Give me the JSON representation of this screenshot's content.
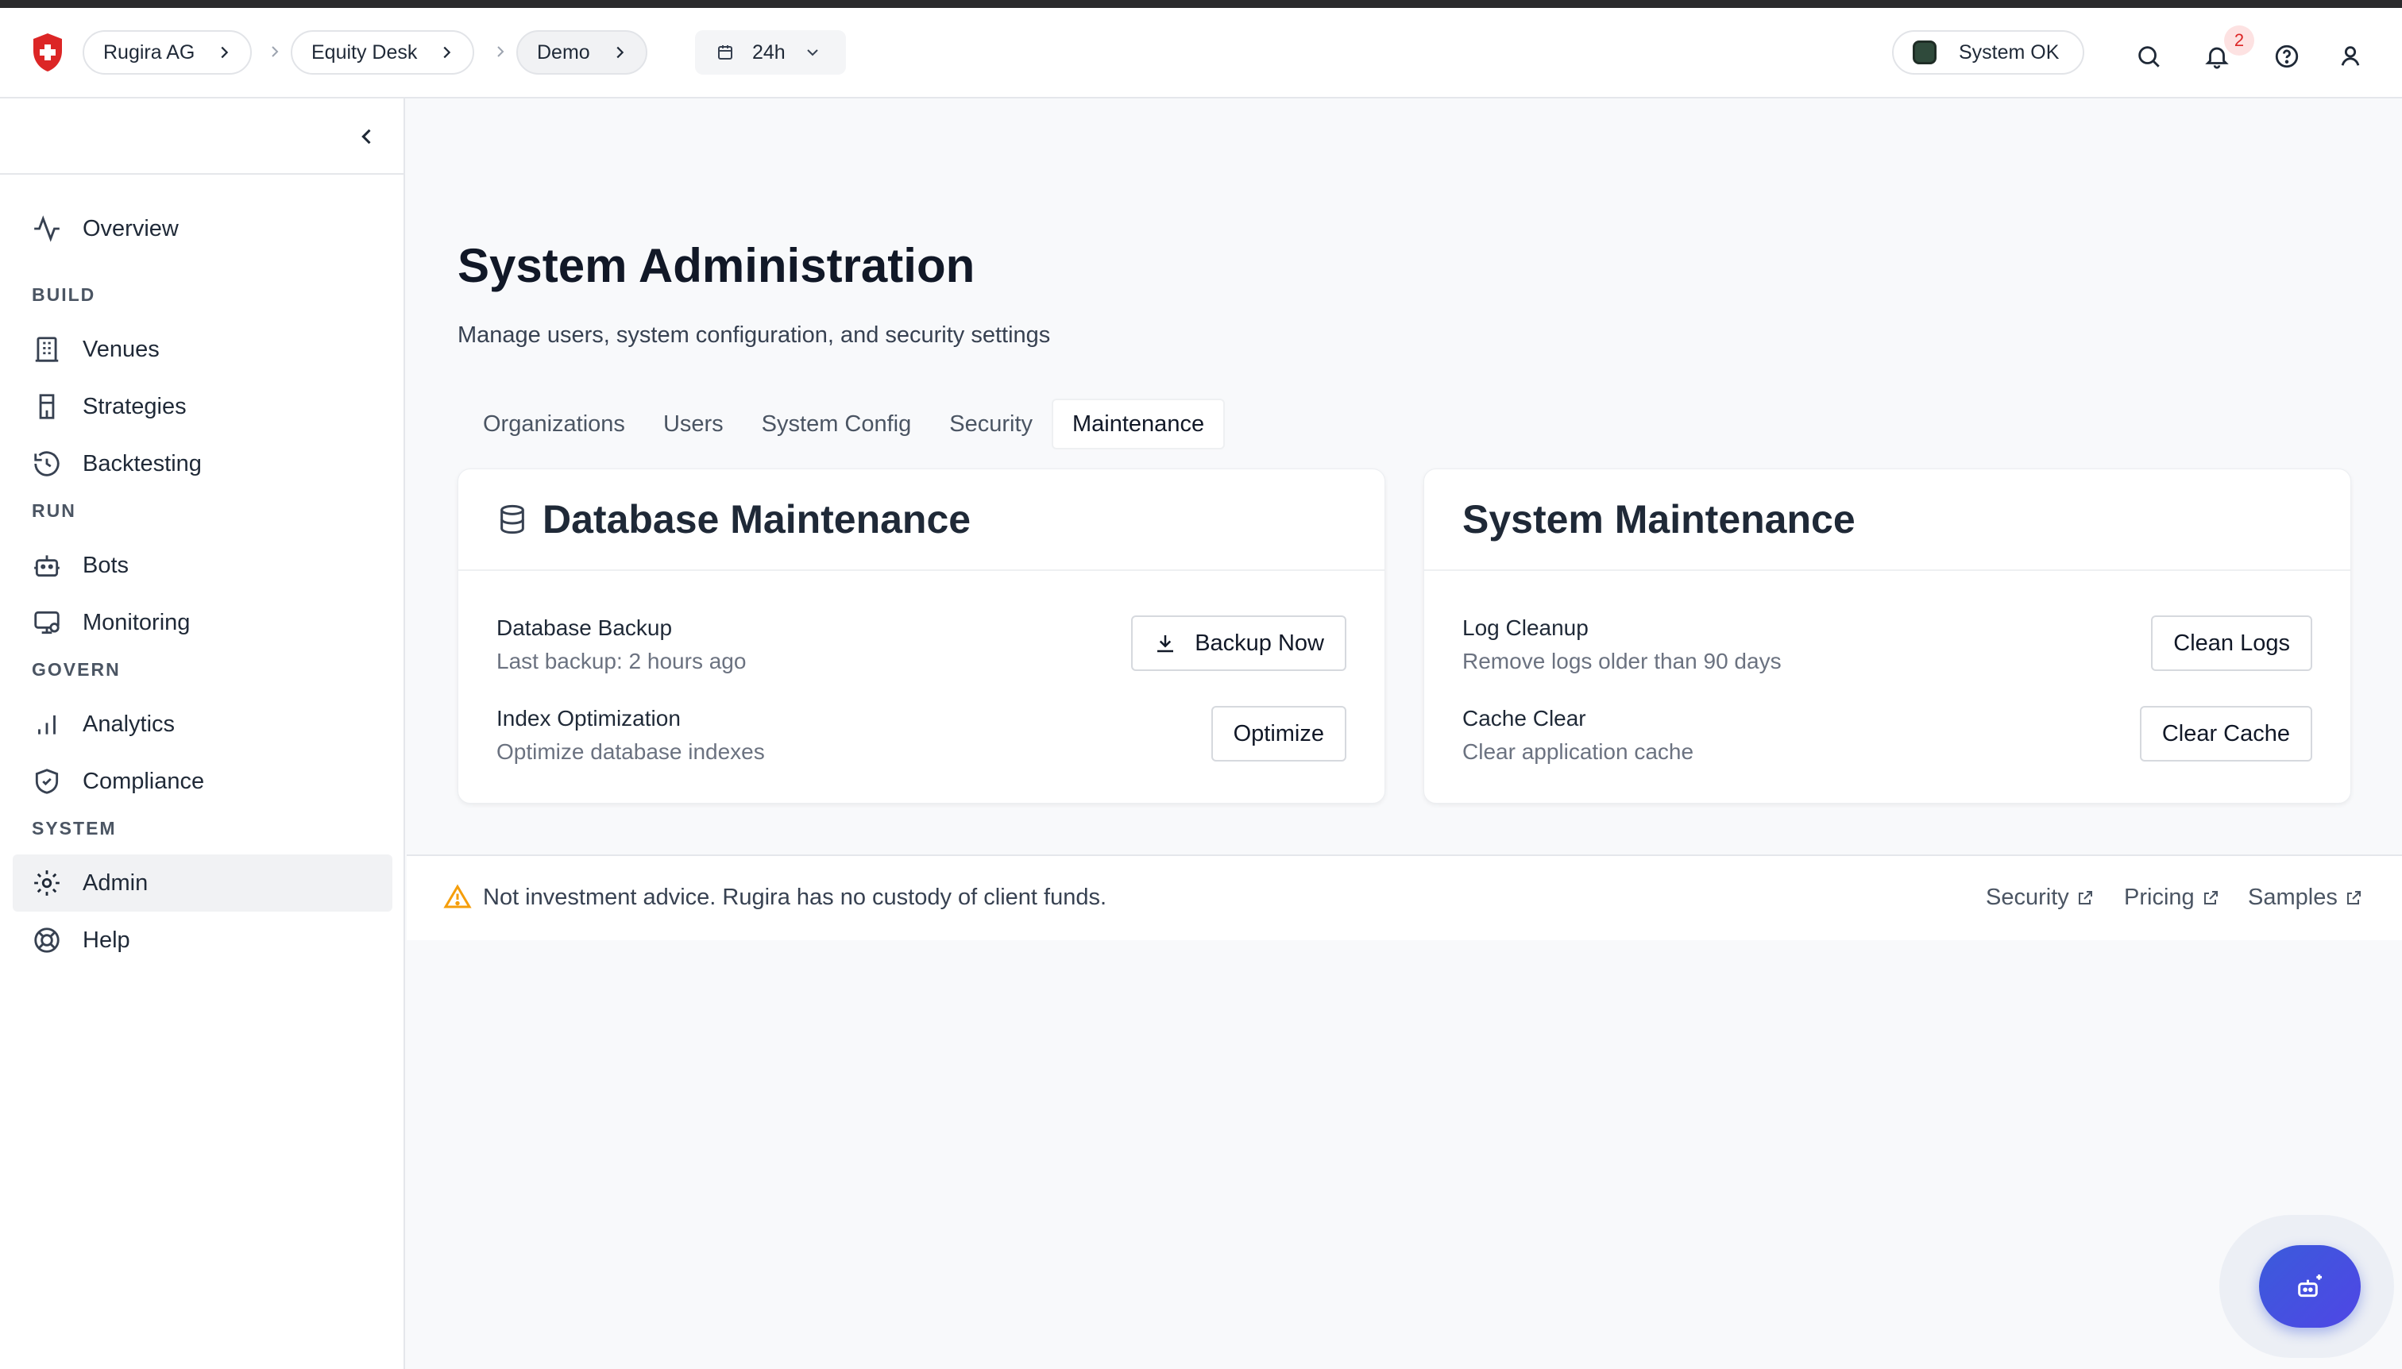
{
  "topbar": {
    "breadcrumbs": [
      {
        "label": "Rugira AG"
      },
      {
        "label": "Equity Desk"
      },
      {
        "label": "Demo"
      }
    ],
    "time_range": "24h",
    "system_status": "System OK",
    "notification_count": "2",
    "brand_color": "#dc2626"
  },
  "sidebar": {
    "items": [
      {
        "label": "Overview",
        "icon": "activity-icon"
      },
      {
        "label": "Venues",
        "icon": "building-icon"
      },
      {
        "label": "Strategies",
        "icon": "strategy-icon"
      },
      {
        "label": "Backtesting",
        "icon": "history-icon"
      },
      {
        "label": "Bots",
        "icon": "bot-icon"
      },
      {
        "label": "Monitoring",
        "icon": "monitor-icon"
      },
      {
        "label": "Analytics",
        "icon": "bar-chart-icon"
      },
      {
        "label": "Compliance",
        "icon": "shield-icon"
      },
      {
        "label": "Admin",
        "icon": "gear-icon"
      },
      {
        "label": "Help",
        "icon": "lifebuoy-icon"
      }
    ],
    "sections": [
      "BUILD",
      "RUN",
      "GOVERN",
      "SYSTEM"
    ]
  },
  "main": {
    "title": "System Administration",
    "subtitle": "Manage users, system configuration, and security settings",
    "tabs": [
      {
        "label": "Organizations"
      },
      {
        "label": "Users"
      },
      {
        "label": "System Config"
      },
      {
        "label": "Security"
      },
      {
        "label": "Maintenance"
      }
    ],
    "active_tab": "Maintenance",
    "db_card": {
      "title": "Database Maintenance",
      "rows": [
        {
          "title": "Database Backup",
          "desc": "Last backup: 2 hours ago",
          "button": "Backup Now"
        },
        {
          "title": "Index Optimization",
          "desc": "Optimize database indexes",
          "button": "Optimize"
        }
      ]
    },
    "sys_card": {
      "title": "System Maintenance",
      "rows": [
        {
          "title": "Log Cleanup",
          "desc": "Remove logs older than 90 days",
          "button": "Clean Logs"
        },
        {
          "title": "Cache Clear",
          "desc": "Clear application cache",
          "button": "Clear Cache"
        }
      ]
    }
  },
  "footer": {
    "disclaimer": "Not investment advice. Rugira has no custody of client funds.",
    "links": [
      {
        "label": "Security"
      },
      {
        "label": "Pricing"
      },
      {
        "label": "Samples"
      }
    ]
  },
  "fab": {
    "icon": "assistant-icon",
    "accent": "#4f46e5"
  }
}
